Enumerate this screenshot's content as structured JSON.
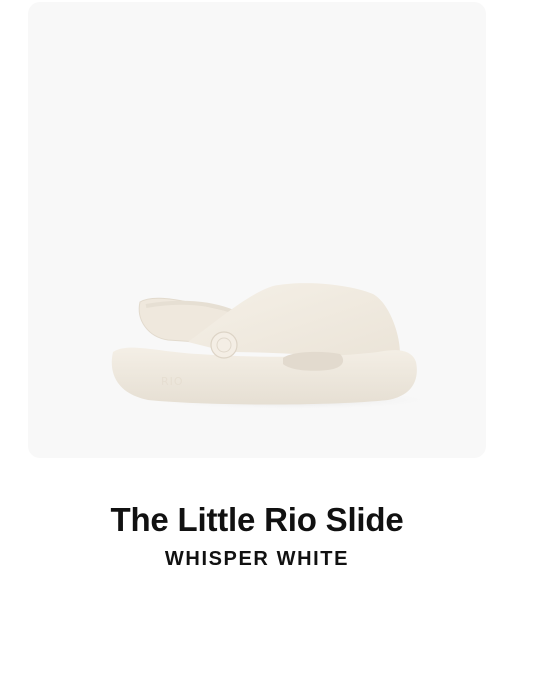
{
  "product": {
    "title": "The Little Rio Slide",
    "color_name": "WHISPER WHITE",
    "image": {
      "alt": "White children's slide sandal with back strap",
      "colors": {
        "card_background": "#f8f8f8",
        "sandal_main": "#f2ece2",
        "sandal_shadow": "#e4dccf"
      }
    }
  }
}
